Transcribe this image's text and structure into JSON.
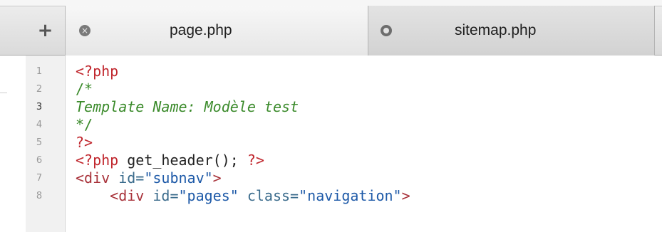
{
  "tabs": {
    "new_tab_label": "+",
    "items": [
      {
        "label": "page.php",
        "state": "active",
        "icon": "close-icon",
        "icon_glyph": "×"
      },
      {
        "label": "sitemap.php",
        "state": "inactive",
        "icon": "unsaved-dot-icon"
      }
    ]
  },
  "colors": {
    "php_tag": "#c0262d",
    "comment": "#3a8a2a",
    "function": "#1d4f8a",
    "html_tag": "#a8323a",
    "attribute": "#3a6b8c",
    "string": "#1e5aa8"
  },
  "editor": {
    "current_line": 3,
    "lines": [
      {
        "num": "1",
        "code": "<?php"
      },
      {
        "num": "2",
        "code": "/*"
      },
      {
        "num": "3",
        "code": "Template Name: Modèle test"
      },
      {
        "num": "4",
        "code": "*/"
      },
      {
        "num": "5",
        "code": "?>"
      },
      {
        "num": "6",
        "tokens": {
          "open": "<?php",
          "call": " get_header(); ",
          "close": "?>"
        }
      },
      {
        "num": "7",
        "tokens": {
          "tag": "<div",
          "attr": " id=",
          "val": "\"subnav\"",
          "end": ">"
        }
      },
      {
        "num": "8",
        "tokens": {
          "indent": "    ",
          "tag": "<div",
          "attr1": " id=",
          "val1": "\"pages\"",
          "attr2": " class=",
          "val2": "\"navigation\"",
          "end": ">"
        }
      }
    ]
  }
}
